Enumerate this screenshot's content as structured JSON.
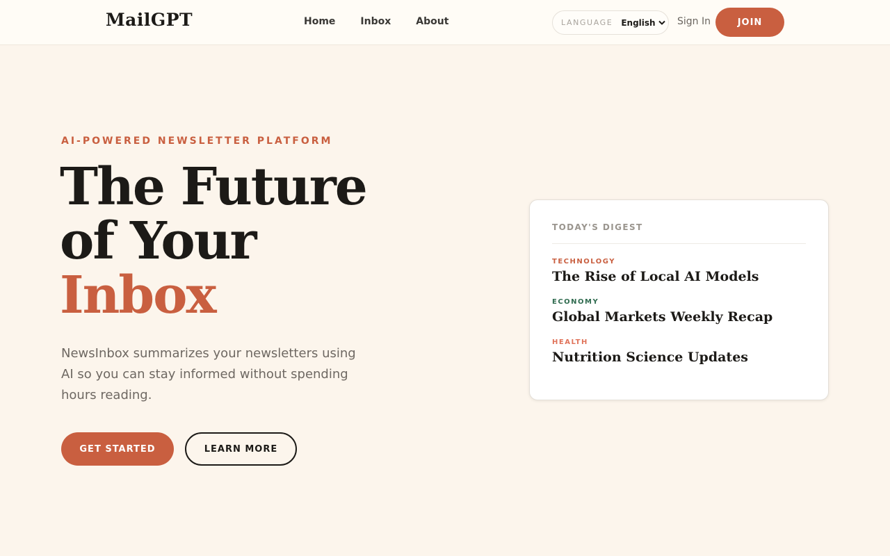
{
  "header": {
    "logo": "MailGPT",
    "nav": [
      "Home",
      "Inbox",
      "About"
    ],
    "language_label": "LANGUAGE",
    "language_value": "English",
    "signin_label": "Sign In",
    "join_label": "JOIN"
  },
  "hero": {
    "eyebrow": "AI-POWERED NEWSLETTER PLATFORM",
    "title_line1": "The Future",
    "title_line2": "of Your",
    "title_line3": "Inbox",
    "description": "NewsInbox summarizes your newsletters using AI so you can stay informed without spending hours reading.",
    "primary_button": "GET STARTED",
    "secondary_button": "LEARN MORE"
  },
  "digest": {
    "title": "TODAY'S DIGEST",
    "items": [
      {
        "category": "TECHNOLOGY",
        "headline": "The Rise of Local AI Models",
        "color": "#c95f40"
      },
      {
        "category": "ECONOMY",
        "headline": "Global Markets Weekly Recap",
        "color": "#2f6b4f"
      },
      {
        "category": "HEALTH",
        "headline": "Nutrition Science Updates",
        "color": "#e0735a"
      }
    ]
  },
  "colors": {
    "accent": "#c95f40",
    "background": "#fcf5ec",
    "text": "#1c1a17"
  },
  "icons": {
    "language_dropdown": "chevron-down-icon"
  }
}
